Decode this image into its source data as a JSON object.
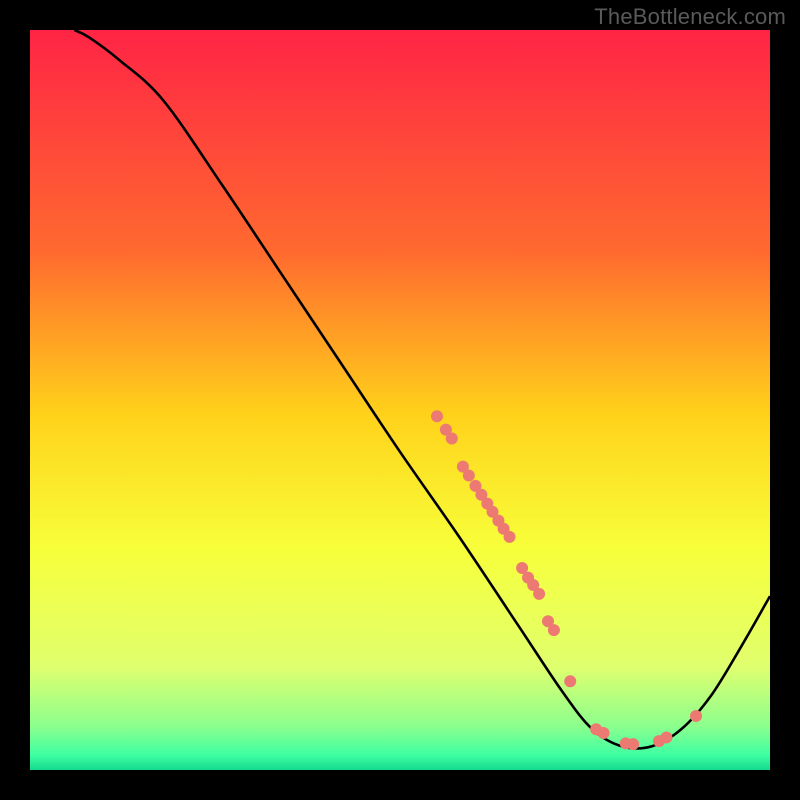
{
  "attribution": "TheBottleneck.com",
  "chart_data": {
    "type": "line",
    "title": "",
    "xlabel": "",
    "ylabel": "",
    "xlim": [
      0,
      100
    ],
    "ylim": [
      0,
      100
    ],
    "gradient_stops": [
      {
        "offset": 0,
        "color": "#ff2445"
      },
      {
        "offset": 30,
        "color": "#ff6a2f"
      },
      {
        "offset": 52,
        "color": "#ffd21a"
      },
      {
        "offset": 70,
        "color": "#f7ff3a"
      },
      {
        "offset": 86,
        "color": "#e0ff6e"
      },
      {
        "offset": 94,
        "color": "#8dff8d"
      },
      {
        "offset": 98,
        "color": "#3effa3"
      },
      {
        "offset": 100,
        "color": "#15d98e"
      }
    ],
    "series": [
      {
        "name": "bottleneck-curve",
        "type": "line",
        "points": [
          {
            "x": 6.0,
            "y": 100.0
          },
          {
            "x": 8.0,
            "y": 99.0
          },
          {
            "x": 12.0,
            "y": 96.0
          },
          {
            "x": 18.0,
            "y": 90.5
          },
          {
            "x": 26.0,
            "y": 79.0
          },
          {
            "x": 34.0,
            "y": 67.0
          },
          {
            "x": 42.0,
            "y": 55.0
          },
          {
            "x": 50.0,
            "y": 43.0
          },
          {
            "x": 58.0,
            "y": 31.5
          },
          {
            "x": 66.0,
            "y": 19.5
          },
          {
            "x": 72.0,
            "y": 10.5
          },
          {
            "x": 76.0,
            "y": 5.5
          },
          {
            "x": 80.0,
            "y": 3.2
          },
          {
            "x": 84.0,
            "y": 3.2
          },
          {
            "x": 88.0,
            "y": 5.5
          },
          {
            "x": 92.0,
            "y": 10.0
          },
          {
            "x": 96.0,
            "y": 16.5
          },
          {
            "x": 100.0,
            "y": 23.5
          }
        ]
      },
      {
        "name": "highlight-dots",
        "type": "scatter",
        "color": "#ec7a72",
        "points": [
          {
            "x": 55.0,
            "y": 47.8,
            "r": 6
          },
          {
            "x": 56.2,
            "y": 46.0,
            "r": 6
          },
          {
            "x": 57.0,
            "y": 44.8,
            "r": 6
          },
          {
            "x": 58.5,
            "y": 41.0,
            "r": 6
          },
          {
            "x": 59.3,
            "y": 39.8,
            "r": 6
          },
          {
            "x": 60.2,
            "y": 38.4,
            "r": 6
          },
          {
            "x": 61.0,
            "y": 37.2,
            "r": 6
          },
          {
            "x": 61.8,
            "y": 36.0,
            "r": 6
          },
          {
            "x": 62.5,
            "y": 34.9,
            "r": 6
          },
          {
            "x": 63.3,
            "y": 33.7,
            "r": 6
          },
          {
            "x": 64.0,
            "y": 32.6,
            "r": 6
          },
          {
            "x": 64.8,
            "y": 31.5,
            "r": 6
          },
          {
            "x": 66.5,
            "y": 27.3,
            "r": 6
          },
          {
            "x": 67.3,
            "y": 26.0,
            "r": 6
          },
          {
            "x": 68.0,
            "y": 25.0,
            "r": 6
          },
          {
            "x": 68.8,
            "y": 23.8,
            "r": 6
          },
          {
            "x": 70.0,
            "y": 20.1,
            "r": 6
          },
          {
            "x": 70.8,
            "y": 18.9,
            "r": 6
          },
          {
            "x": 73.0,
            "y": 12.0,
            "r": 6
          },
          {
            "x": 76.5,
            "y": 5.5,
            "r": 6
          },
          {
            "x": 77.5,
            "y": 5.0,
            "r": 6
          },
          {
            "x": 80.5,
            "y": 3.6,
            "r": 6
          },
          {
            "x": 81.5,
            "y": 3.5,
            "r": 6
          },
          {
            "x": 85.0,
            "y": 3.9,
            "r": 6
          },
          {
            "x": 86.0,
            "y": 4.4,
            "r": 6
          },
          {
            "x": 90.0,
            "y": 7.3,
            "r": 6
          }
        ]
      }
    ]
  }
}
